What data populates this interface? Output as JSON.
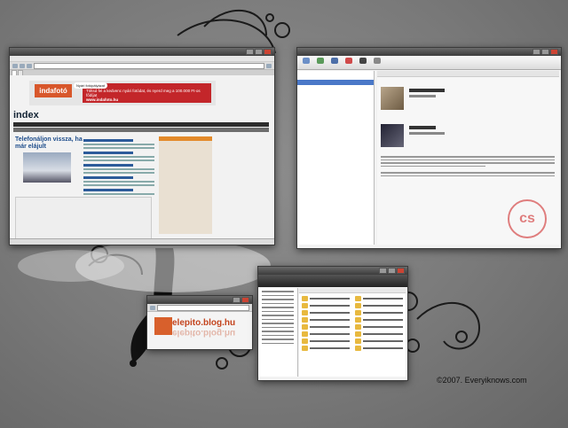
{
  "browser": {
    "banner_logo": "indafotó",
    "ad_bubble": "Nyári fotópályázat",
    "ad_text": "Töltsd fel a kedvenc nyári fotódat, és nyerd meg a 100.000 Ft-os fődíjat",
    "ad_site": "www.indafoto.hu",
    "site_logo": "index",
    "headline": "Telefonáljon vissza, ha már elájult"
  },
  "blog": {
    "text": "elepito.blog.hu"
  },
  "credit": "©2007. Everyiknows.com",
  "cs_logo": "cs"
}
